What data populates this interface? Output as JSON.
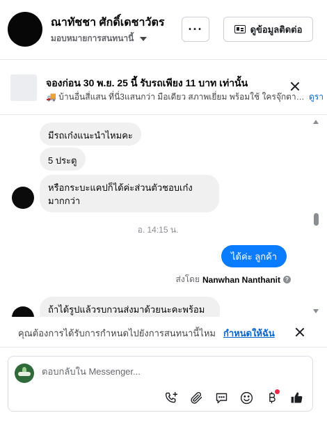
{
  "header": {
    "contact_name": "ณาทัชชา ศักดิ์เดชาวัตร",
    "assign_label": "มอบหมายการสนทนานี้",
    "more_label": "···",
    "contact_info_label": "ดูข้อมูลติดต่อ"
  },
  "ad": {
    "title": "จองก่อน 30 พ.ย. 25 นี้ รับรถเพียง 11 บาท เท่านั้น",
    "description": "🚚 บ้านอื่นสี่แสน ที่นี่3แสนกว่า มือเดียว สภาพเยี่ยม พร้อมใช้ ใครจุ๊กตามหา ...",
    "link": "ดูรา"
  },
  "messages": [
    {
      "text": "มีรถเก๋งแนะนำไหมคะ",
      "direction": "in"
    },
    {
      "text": "5 ประตู",
      "direction": "in"
    },
    {
      "text": "หรือกระบะแคปก็ได้ค่ะส่วนตัวชอบเก๋งมากกว่า",
      "direction": "in"
    },
    {
      "text": "ได้ค่ะ  ลูกค้า",
      "direction": "out"
    },
    {
      "text": "ถ้าได้รูปแล้วรบกวนส่งมาด้วยนะคะพร้อม",
      "direction": "in"
    }
  ],
  "timestamp": "อ. 14:15 น.",
  "sent_by": {
    "prefix": "ส่งโดย",
    "name": "Nanwhan Nanthanit",
    "help": "?"
  },
  "notice": {
    "text": "คุณต้องการได้รับการกำหนดไปยังการสนทนานี้ไหม",
    "link": "กำหนดให้ฉัน"
  },
  "composer": {
    "placeholder": "ตอบกลับใน Messenger...",
    "tools": [
      "call-add-icon",
      "attach-icon",
      "saved-reply-icon",
      "emoji-icon",
      "baht-icon",
      "like-icon"
    ]
  },
  "colors": {
    "accent": "#0a7cff",
    "link": "#0064d1",
    "incoming_bubble": "#f0f0f0",
    "badge": "#f02849"
  }
}
